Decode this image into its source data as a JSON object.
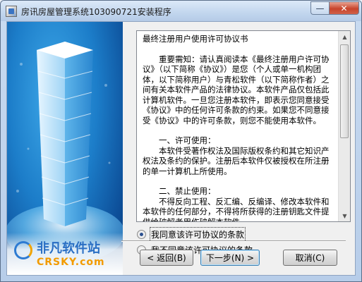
{
  "window": {
    "title": "房讯房屋管理系统103090721安装程序",
    "minimize_glyph": "—",
    "close_glyph": "✕"
  },
  "side_image": {
    "watermark_cn": "非凡软件站",
    "watermark_en": "CRSKY.com"
  },
  "license": {
    "heading": "最终注册用户使用许可协议书",
    "intro": "重要需知：请认真阅读本《最终注册用户许可协议》（以下简称《协议》）是您（个人或单一机构团体，以下简称用户）与青松软件（以下简称作者）之间有关本软件产品的法律协议。本软件产品仅包括此计算机软件。一旦您注册本软件，即表示您同意接受《协议》中的任何许可条款的约束。如果您不同意接受《协议》中的许可条款，则您不能使用本软件。",
    "section1_title": "一、许可使用：",
    "section1_body": "本软件受著作权法及国际版权条约和其它知识产权法及条约的保护。注册后本软件仅被授权在所注册的单一计算机上所使用。",
    "section2_title": "二、禁止使用：",
    "section2_body": "不得反向工程、反汇编、反编译、修改本软件和本软件的任何部分，不得将所获得的注册钥匙文件提供给破解者用作破解本软件。"
  },
  "options": {
    "agree_label": "我同意该许可协议的条款",
    "disagree_label": "我不同意该许可协议的条款",
    "selected": "agree"
  },
  "buttons": {
    "back": "< 返回(B)",
    "next": "下一步(N) >",
    "cancel": "取消(C)"
  }
}
